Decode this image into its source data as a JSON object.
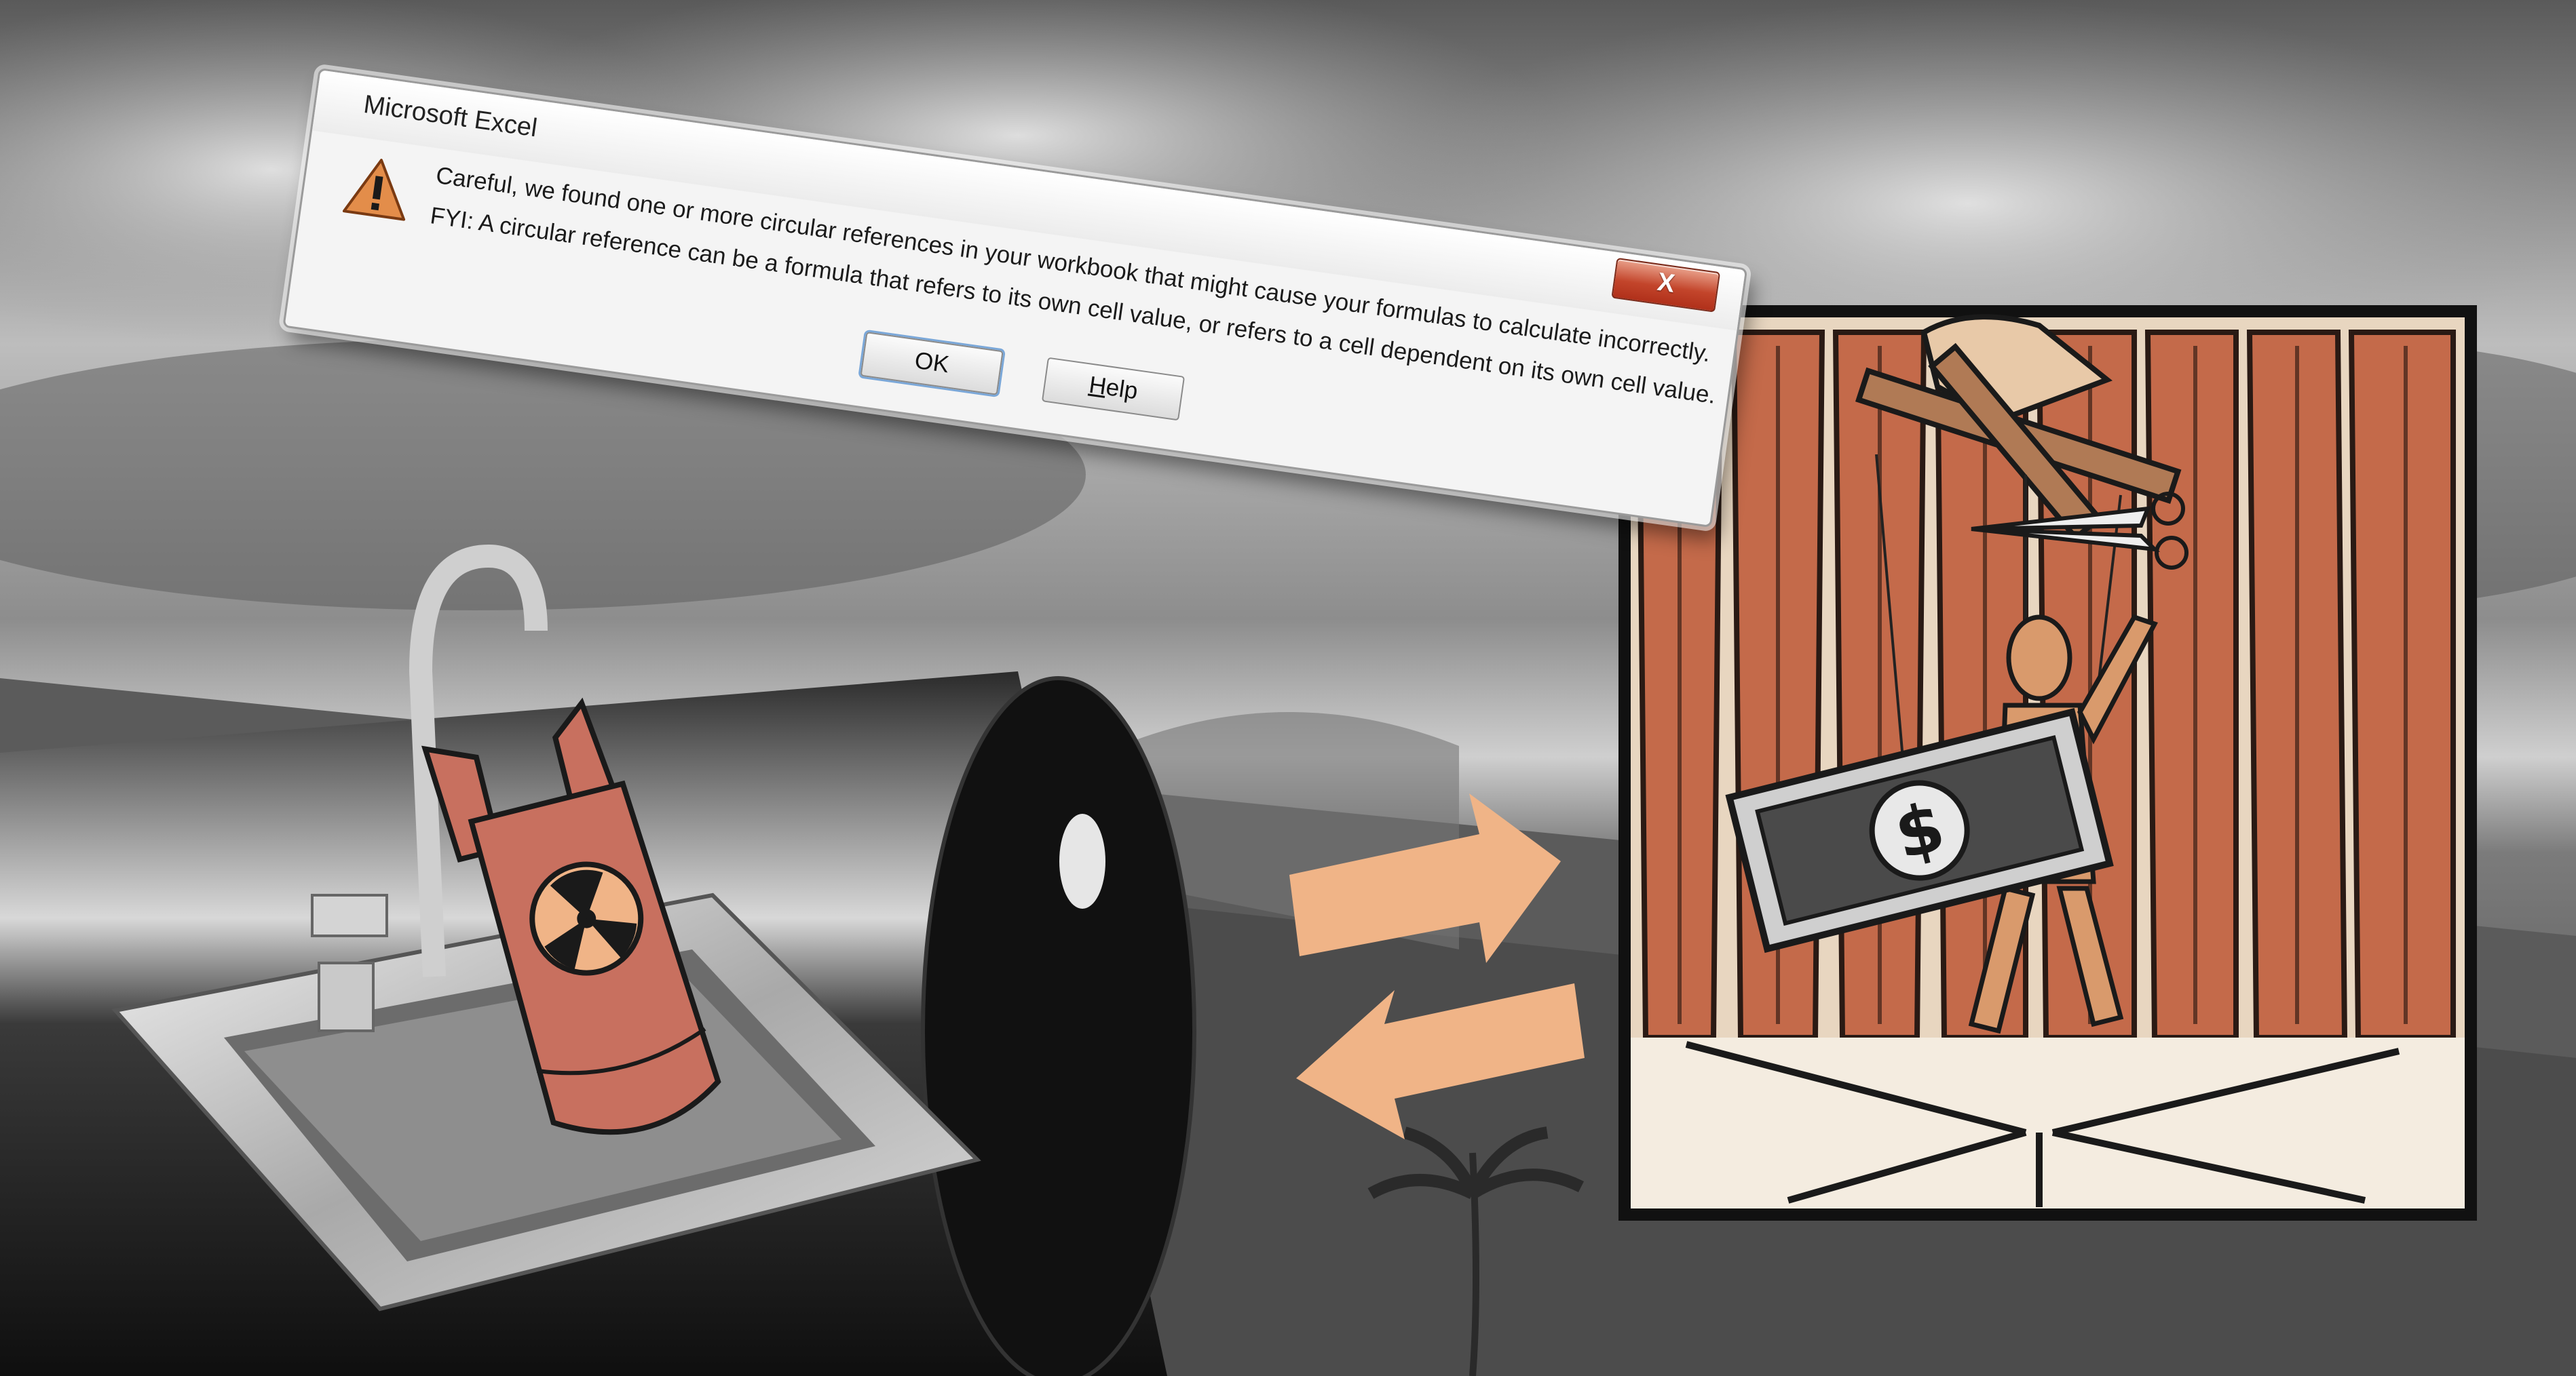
{
  "dialog": {
    "title": "Microsoft Excel",
    "close_label": "X",
    "icon": "warning-triangle-icon",
    "message_line1": "Careful, we found one or more circular references in your workbook that might cause your formulas to calculate incorrectly.",
    "message_line2": "FYI: A circular reference can be a formula that refers to its own cell value, or refers to a cell dependent on its own cell value.",
    "ok_label": "OK",
    "help_label_prefix": "H",
    "help_label_rest": "elp"
  },
  "artwork": {
    "money_symbol": "$",
    "bomb_icon": "radiation-icon",
    "arrows_icon": "swap-arrows-icon"
  },
  "colors": {
    "bomb": "#c8705f",
    "arrow": "#f0b487",
    "curtain": "#c46a4a",
    "close_button": "#c3452b"
  }
}
